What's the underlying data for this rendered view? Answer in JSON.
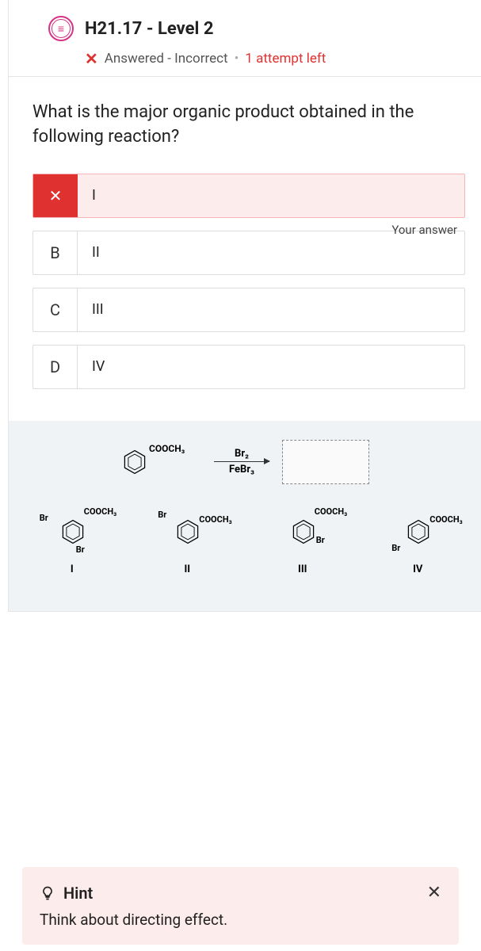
{
  "header": {
    "title": "H21.17 - Level 2",
    "status": "Answered - Incorrect",
    "attempts": "1 attempt left"
  },
  "question": "What is the major organic product obtained in the following reaction?",
  "your_answer_label": "Your answer",
  "options": [
    {
      "letter": "✕",
      "text": "I",
      "selected": true
    },
    {
      "letter": "B",
      "text": "II",
      "selected": false
    },
    {
      "letter": "C",
      "text": "III",
      "selected": false
    },
    {
      "letter": "D",
      "text": "IV",
      "selected": false
    }
  ],
  "reaction": {
    "substituent": "COOCH₃",
    "reagent1": "Br₂",
    "reagent2": "FeBr₃"
  },
  "products": [
    {
      "roman": "I",
      "sub": "COOCH₃",
      "br1": "Br",
      "br2": "Br"
    },
    {
      "roman": "II",
      "sub": "COOCH₃",
      "br1": "Br"
    },
    {
      "roman": "III",
      "sub": "COOCH₃",
      "br1": "Br"
    },
    {
      "roman": "IV",
      "sub": "COOCH₃",
      "br1": "Br"
    }
  ],
  "hint": {
    "title": "Hint",
    "body": "Think about directing effect."
  }
}
